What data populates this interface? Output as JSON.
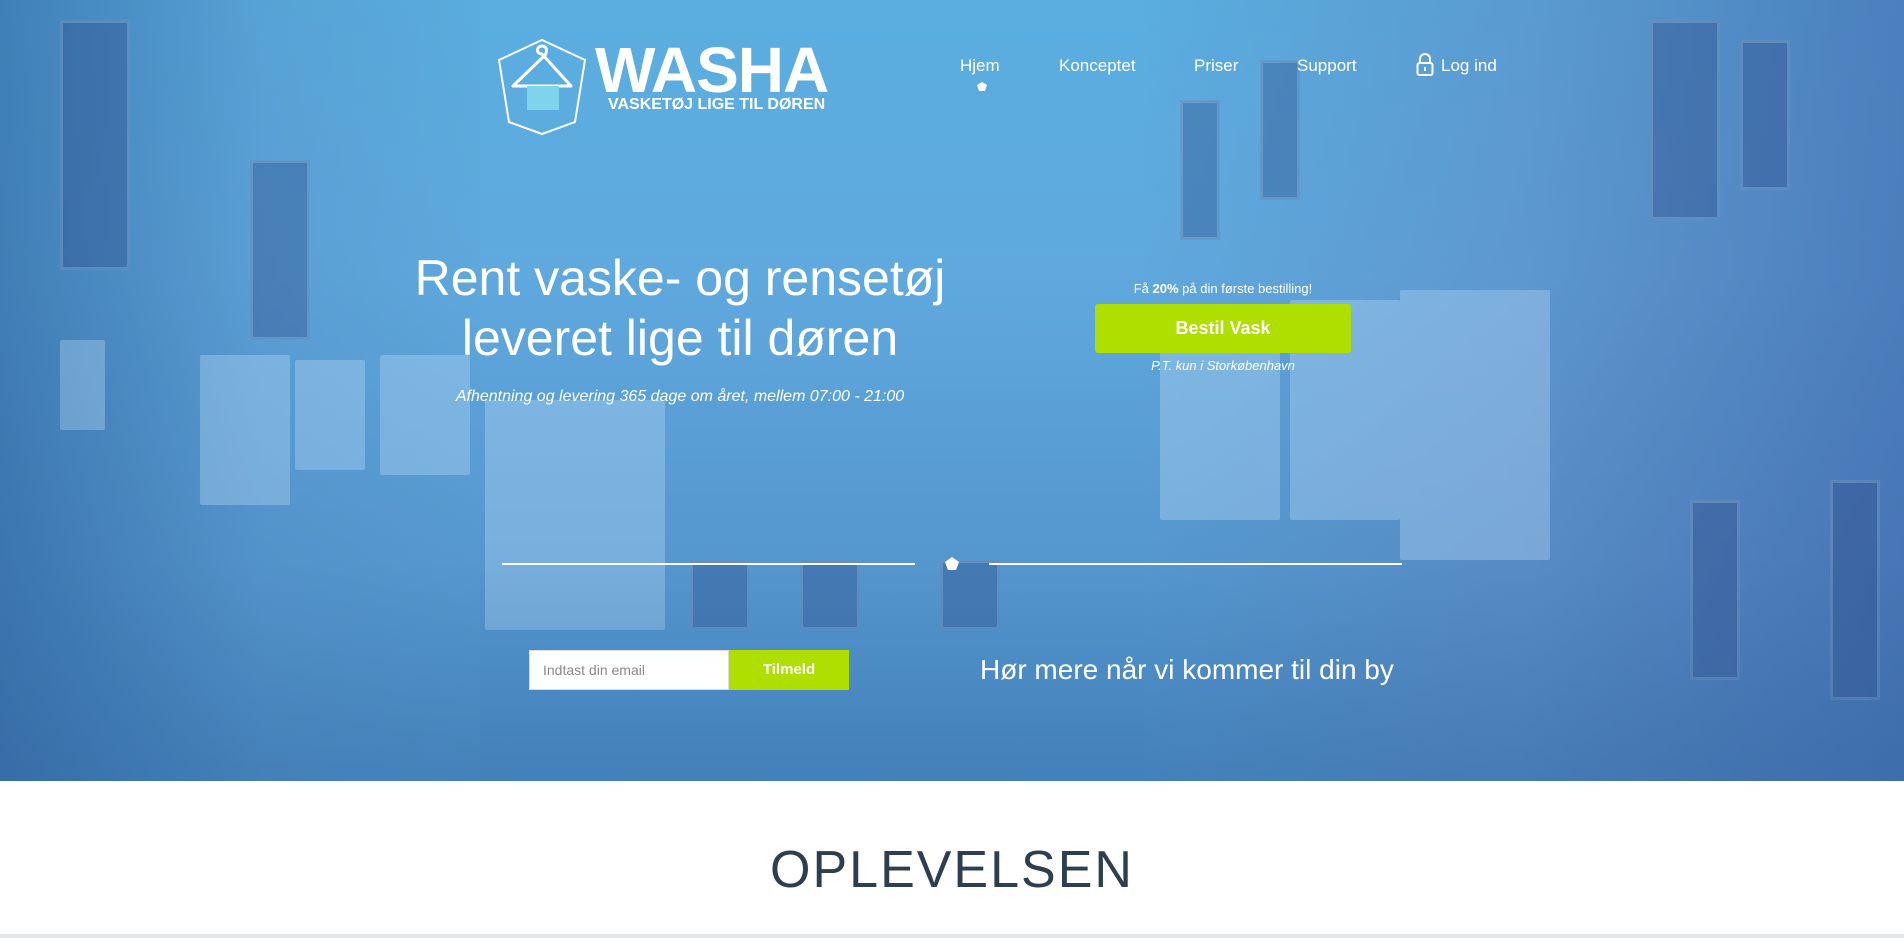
{
  "brand": {
    "name": "WASHA",
    "tagline": "VASKETØJ LIGE TIL DØREN"
  },
  "nav": {
    "items": [
      {
        "label": "Hjem",
        "active": true
      },
      {
        "label": "Konceptet"
      },
      {
        "label": "Priser"
      },
      {
        "label": "Support"
      }
    ],
    "login_label": "Log ind",
    "login_icon": "lock-icon"
  },
  "hero": {
    "headline_line1": "Rent vaske- og rensetøj",
    "headline_line2": "leveret lige til døren",
    "subline": "Afhentning og levering 365 dage om året, mellem 07:00 - 21:00"
  },
  "cta": {
    "promo_prefix": "Få ",
    "promo_highlight": "20%",
    "promo_suffix": " på din første bestilling!",
    "button_label": "Bestil Vask",
    "note": "P.T. kun i Storkøbenhavn"
  },
  "signup": {
    "email_placeholder": "Indtast din email",
    "button_label": "Tilmeld",
    "text": "Hør mere når vi kommer til din by"
  },
  "section": {
    "title": "OPLEVELSEN"
  },
  "colors": {
    "accent_green": "#aedf00",
    "hero_blue": "#5aaee0",
    "heading_dark": "#2c3e50"
  }
}
